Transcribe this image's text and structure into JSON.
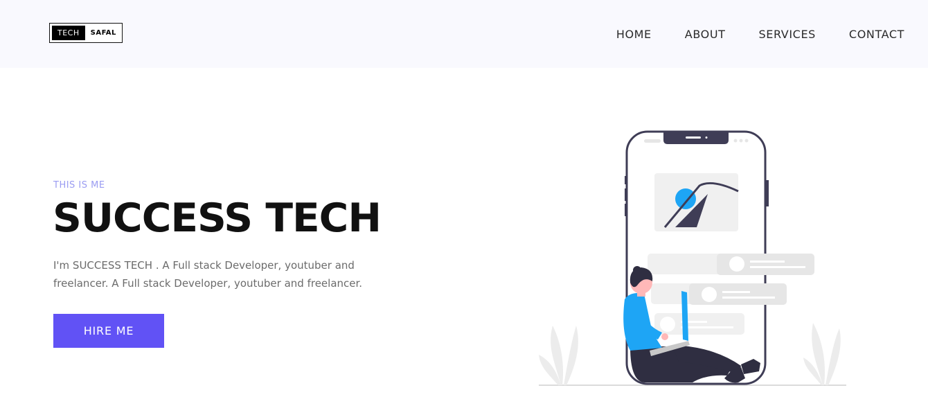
{
  "header": {
    "logo": {
      "part1": "TECH",
      "part2": "SAFAL"
    },
    "nav": [
      {
        "label": "HOME"
      },
      {
        "label": "ABOUT"
      },
      {
        "label": "SERVICES"
      },
      {
        "label": "CONTACT"
      }
    ]
  },
  "hero": {
    "eyebrow": "THIS IS ME",
    "title": "SUCCESS TECH",
    "description": "I'm SUCCESS TECH . A Full stack Developer, youtuber and freelancer. A Full stack Developer, youtuber and freelancer.",
    "cta_label": "HIRE ME"
  },
  "colors": {
    "accent": "#6152f5",
    "eyebrow": "#9a9cf2",
    "header_bg": "#f9f9fe",
    "illustration_blue": "#1ea5f5"
  },
  "illustration": {
    "icon": "person-with-laptop-and-phone-illustration"
  }
}
